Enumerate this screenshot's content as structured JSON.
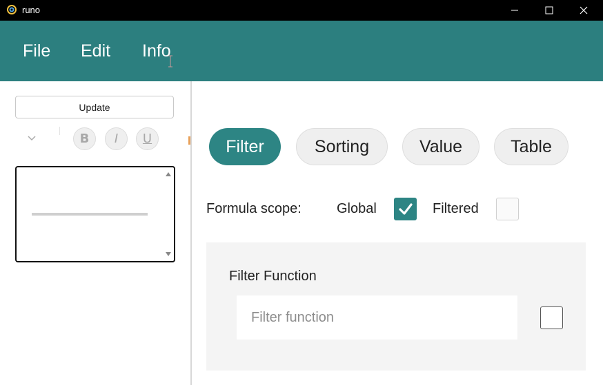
{
  "window": {
    "title": "runo",
    "controls": [
      "minimize-icon",
      "maximize-icon",
      "close-icon"
    ]
  },
  "menubar": {
    "items": [
      {
        "label": "File"
      },
      {
        "label": "Edit"
      },
      {
        "label": "Info"
      }
    ]
  },
  "left_panel": {
    "update_label": "Update",
    "format_buttons": [
      {
        "label": "B",
        "icon": "bold-icon"
      },
      {
        "label": "I",
        "icon": "italic-icon"
      },
      {
        "label": "U",
        "icon": "underline-icon"
      }
    ]
  },
  "tabs": [
    {
      "label": "Filter",
      "active": true
    },
    {
      "label": "Sorting",
      "active": false
    },
    {
      "label": "Value",
      "active": false
    },
    {
      "label": "Table",
      "active": false
    }
  ],
  "scope": {
    "label": "Formula scope:",
    "options": [
      {
        "label": "Global",
        "checked": true
      },
      {
        "label": "Filtered",
        "checked": false
      }
    ]
  },
  "filter_function": {
    "title": "Filter Function",
    "value": "",
    "placeholder": "Filter function",
    "checked": false
  },
  "colors": {
    "accent": "#2c7f7f",
    "titlebar": "#000000"
  }
}
